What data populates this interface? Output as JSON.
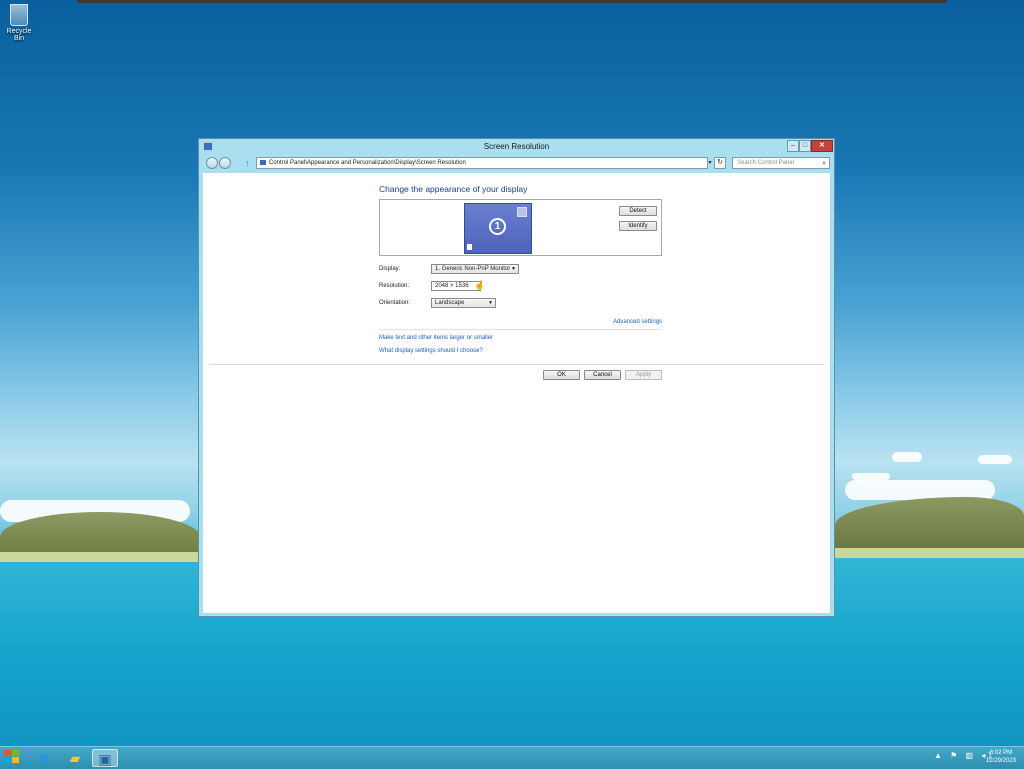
{
  "desktop": {
    "recycle_bin_label": "Recycle Bin"
  },
  "window": {
    "title": "Screen Resolution",
    "minimize_label": "–",
    "maximize_label": "□",
    "close_label": "✕"
  },
  "navbar": {
    "address_path": "Control Panel\\Appearance and Personalization\\Display\\Screen Resolution",
    "dropdown_glyph": "▾",
    "refresh_glyph": "↻",
    "search_placeholder": "Search Control Panel",
    "search_glyph": "⌕",
    "up_glyph": "↑"
  },
  "content": {
    "heading": "Change the appearance of your display",
    "monitor_number": "1",
    "detect_label": "Detect",
    "identify_label": "Identify",
    "display_label": "Display:",
    "display_value": "1. Generic Non-PnP Monitor",
    "resolution_label": "Resolution:",
    "resolution_value": "2048 × 1536",
    "orientation_label": "Orientation:",
    "orientation_value": "Landscape",
    "advanced_link": "Advanced settings",
    "text_size_link": "Make text and other items larger or smaller",
    "help_link": "What display settings should I choose?",
    "ok_label": "OK",
    "cancel_label": "Cancel",
    "apply_label": "Apply"
  },
  "taskbar": {
    "ie_glyph": "e",
    "explorer_glyph": "▰",
    "control_panel_glyph": "▣",
    "tray_icons": "▲ ⚑ ▥ ◂)",
    "time": "6:02 PM",
    "date": "12/29/2023"
  },
  "colors": {
    "link": "#1f5fbf",
    "heading": "#1e3d8f",
    "taskbar": "#2d8fb1",
    "close_button": "#c7413a"
  }
}
